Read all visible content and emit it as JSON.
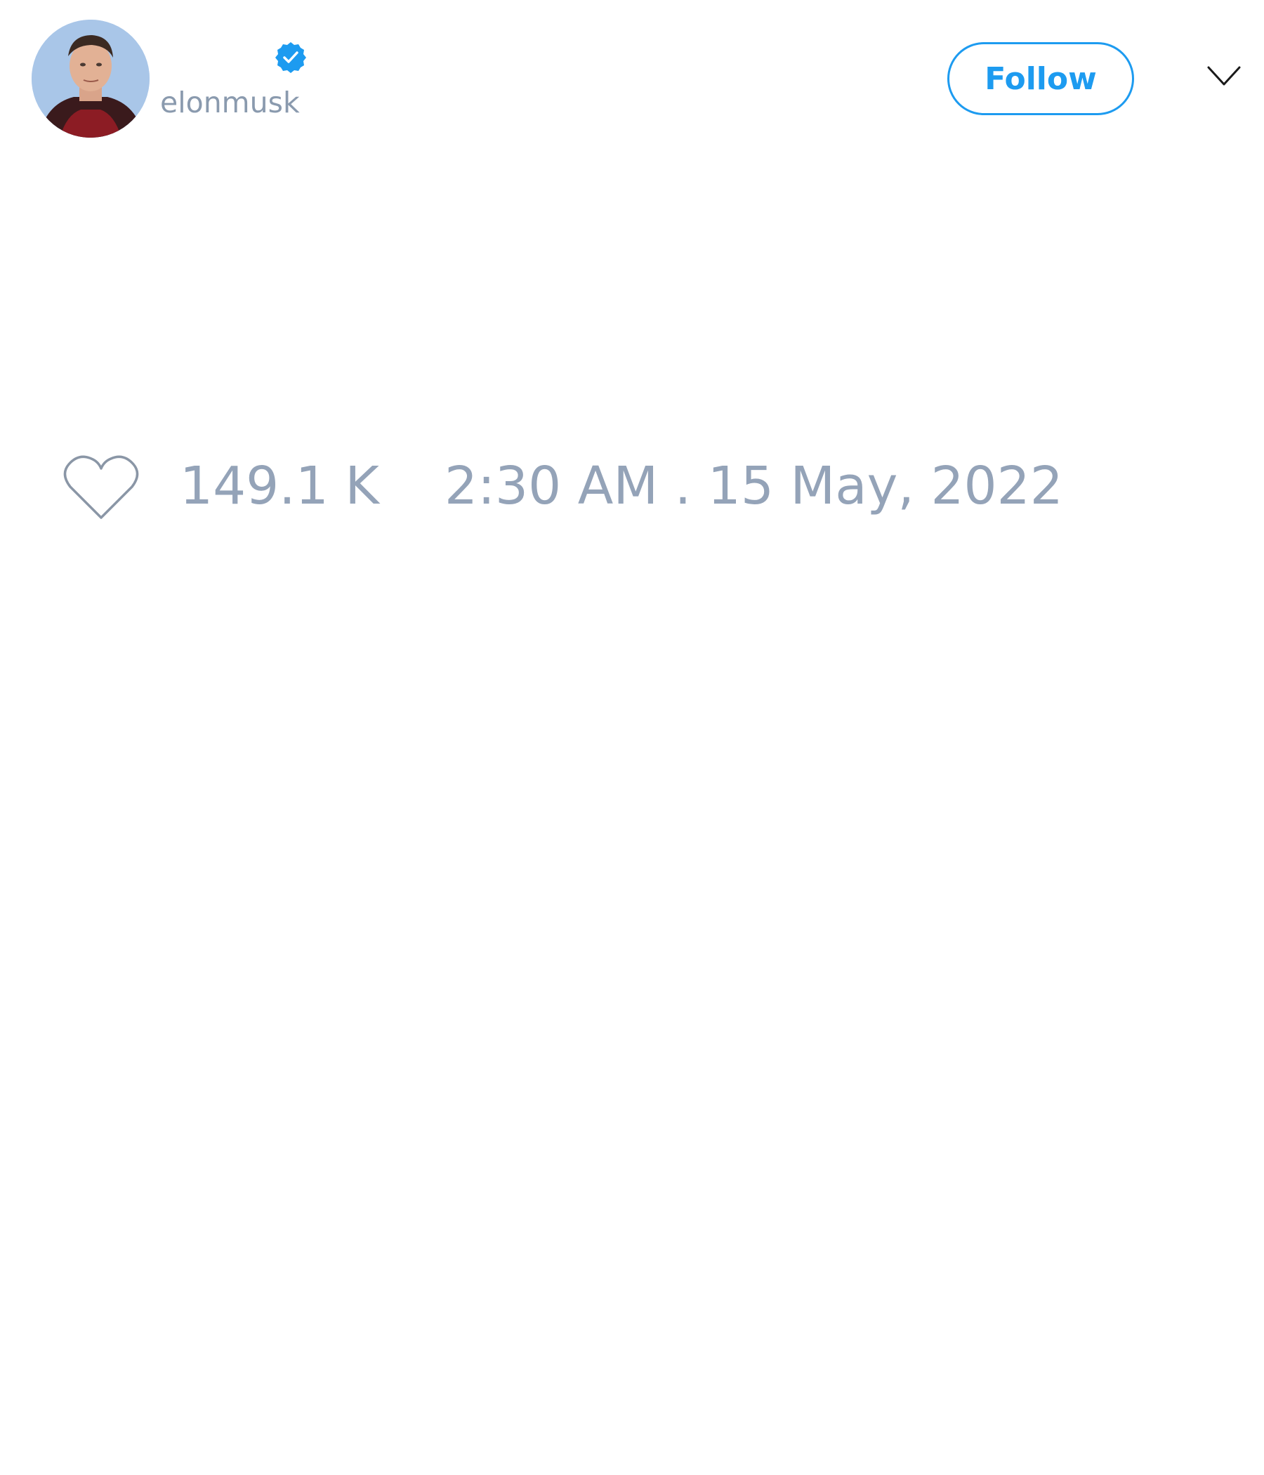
{
  "user": {
    "display_name": "",
    "handle": "elonmusk",
    "verified": true,
    "avatar_icon": "profile-photo"
  },
  "actions": {
    "follow_label": "Follow",
    "menu_icon": "chevron-down-icon"
  },
  "stats": {
    "like_icon": "heart-icon",
    "likes": "149.1 K",
    "timestamp": "2:30 AM . 15 May, 2022"
  },
  "colors": {
    "accent": "#1d9bf0",
    "muted_text": "#94a3b8",
    "background": "#ffffff"
  }
}
